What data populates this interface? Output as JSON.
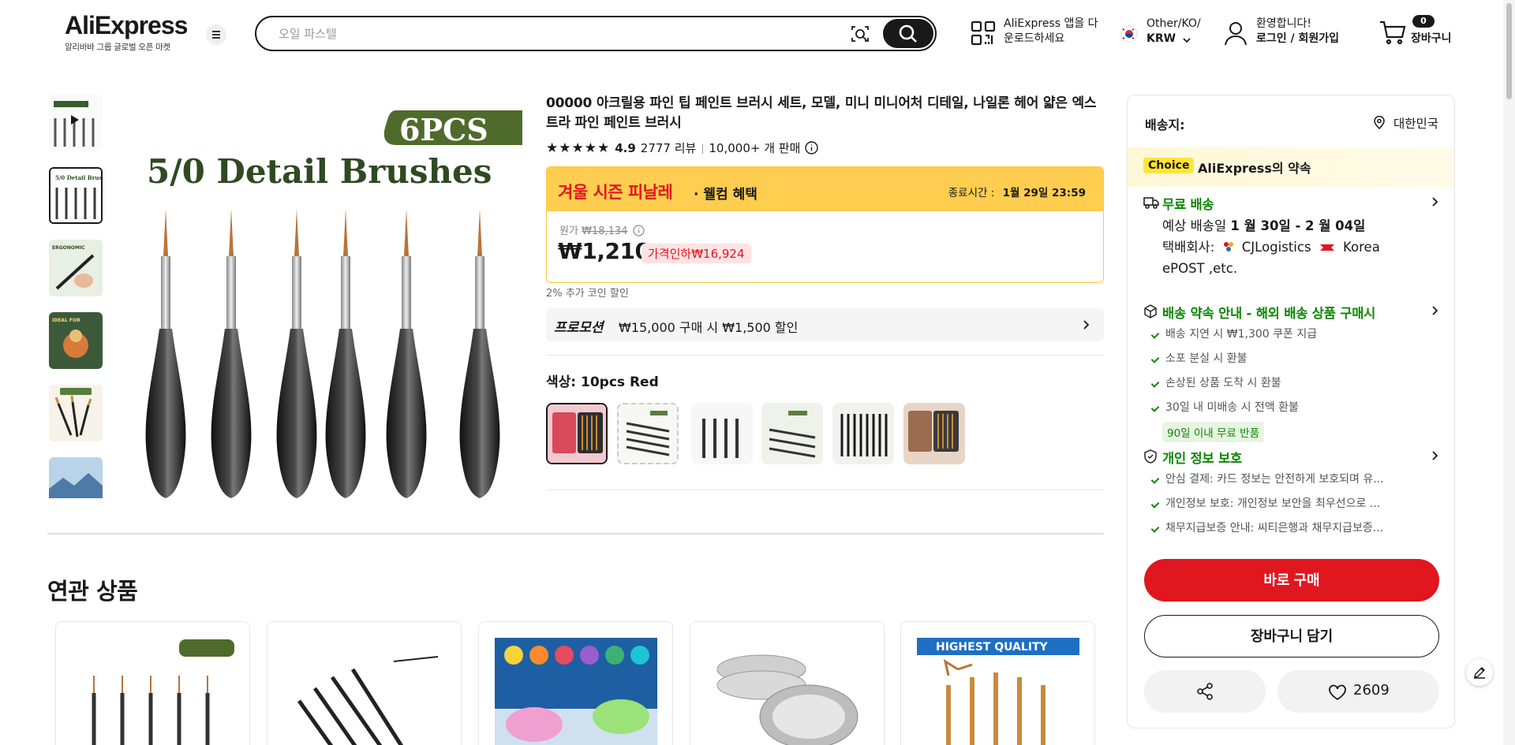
{
  "header": {
    "logo": "AliExpress",
    "logo_sub": "알리바바 그룹 글로벌 오픈 마켓",
    "search_placeholder": "오일 파스텔",
    "app_line1": "AliExpress 앱을 다",
    "app_line2": "운로드하세요",
    "locale_line1": "Other/KO/",
    "locale_line2": "KRW",
    "account_line1": "환영합니다!",
    "account_line2": "로그인 / 회원가입",
    "cart_count": "0",
    "cart_label": "장바구니"
  },
  "gallery": {
    "main_image_text": "5/0 Detail Brushes",
    "main_image_badge": "6PCS",
    "thumbnails": [
      "video",
      "detail-brushes",
      "brush-in-hand",
      "painting-figure",
      "nylon-hair",
      "landscape"
    ]
  },
  "product": {
    "title": "00000 아크릴용 파인 팁 페인트 브러시 세트, 모델, 미니 미니어처 디테일, 나일론 헤어 얇은 엑스트라 파인 페인트 브러시",
    "rating": "4.9",
    "reviews": "2777 리뷰",
    "sold": "10,000+ 개 판매",
    "promo_sale": "겨울 시즌 피날레",
    "promo_welcome": "· 웰컴 혜택",
    "promo_ends_label": "종료시간 :",
    "promo_ends_time": "1월 29일 23:59",
    "orig_price_label": "원가",
    "orig_price": "₩18,134",
    "price": "₩1,210",
    "discount": "가격인하₩16,924",
    "coin_note": "2% 추가 코인 할인",
    "promo_label": "프로모션",
    "promo_text": "₩15,000 구매 시 ₩1,500 할인",
    "color_label": "색상:",
    "color_value": "10pcs Red"
  },
  "related": {
    "title": "연관 상품"
  },
  "panel": {
    "ship_to_label": "배송지:",
    "ship_to_value": "대한민국",
    "choice_badge": "Choice",
    "choice_text": "AliExpress의 약속",
    "free_shipping": "무료 배송",
    "delivery_prefix": "예상 배송일",
    "delivery_range": "1 월 30일 - 2 월 04일",
    "carrier_prefix": "택배회사:",
    "carrier_1": "CJLogistics",
    "carrier_2": "Korea",
    "carrier_3": "ePOST ,etc.",
    "promise_title": "배송 약속 안내 - 해외 배송 상품 구매시",
    "promise_items": [
      "배송 지연 시 ₩1,300 쿠폰 지급",
      "소포 분실 시 환불",
      "손상된 상품 도착 시 환불",
      "30일 내 미배송 시 전액 환불"
    ],
    "return_badge": "90일 이내 무료 반품",
    "privacy_title": "개인 정보 보호",
    "privacy_items": [
      "안심 결제: 카드 정보는 안전하게 보호되며 유...",
      "개인정보 보호: 개인정보 보안을 최우선으로 ...",
      "채무지급보증 안내: 씨티은행과 채무지급보증..."
    ],
    "buy_now": "바로 구매",
    "add_to_cart": "장바구니 담기",
    "wishlist_count": "2609"
  },
  "colors": {
    "accent": "#e0171f",
    "green": "#0a8800",
    "banner": "#ffcd4f"
  }
}
